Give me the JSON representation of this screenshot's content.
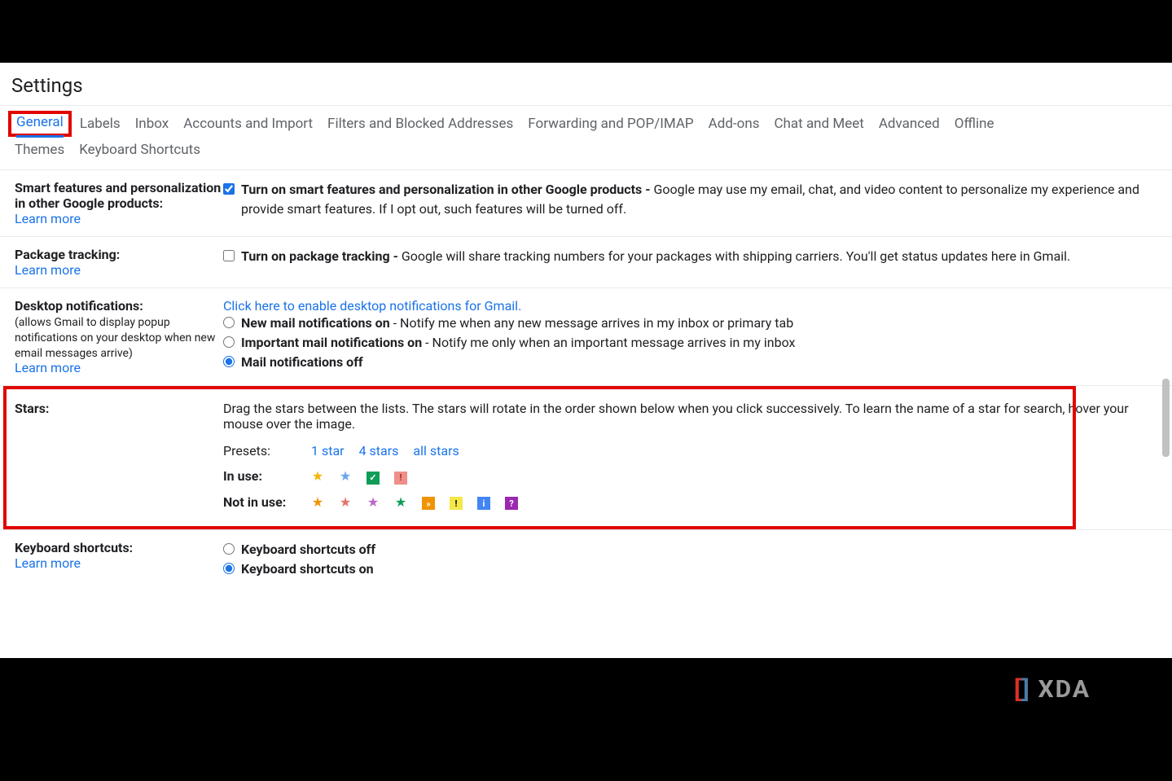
{
  "page_title": "Settings",
  "tabs": {
    "row1": [
      "General",
      "Labels",
      "Inbox",
      "Accounts and Import",
      "Filters and Blocked Addresses",
      "Forwarding and POP/IMAP",
      "Add-ons",
      "Chat and Meet",
      "Advanced",
      "Offline"
    ],
    "row2": [
      "Themes",
      "Keyboard Shortcuts"
    ],
    "active": "General"
  },
  "learn_more": "Learn more",
  "sections": {
    "smart_features": {
      "label": "Smart features and personalization in other Google products:",
      "checkbox_label": "Turn on smart features and personalization in other Google products - ",
      "description": "Google may use my email, chat, and video content to personalize my experience and provide smart features. If I opt out, such features will be turned off.",
      "checked": true
    },
    "package_tracking": {
      "label": "Package tracking:",
      "checkbox_label": "Turn on package tracking - ",
      "description": "Google will share tracking numbers for your packages with shipping carriers. You'll get status updates here in Gmail.",
      "checked": false
    },
    "desktop_notifications": {
      "label": "Desktop notifications:",
      "sublabel": "(allows Gmail to display popup notifications on your desktop when new email messages arrive)",
      "enable_link": "Click here to enable desktop notifications for Gmail.",
      "options": [
        {
          "label": "New mail notifications on",
          "desc": " - Notify me when any new message arrives in my inbox or primary tab",
          "checked": false
        },
        {
          "label": "Important mail notifications on",
          "desc": " - Notify me only when an important message arrives in my inbox",
          "checked": false
        },
        {
          "label": "Mail notifications off",
          "desc": "",
          "checked": true
        }
      ]
    },
    "stars": {
      "label": "Stars:",
      "instruction_bold": "Drag the stars between the lists.",
      "instruction_rest": "  The stars will rotate in the order shown below when you click successively. To learn the name of a star for search, hover your mouse over the image.",
      "presets_label": "Presets:",
      "presets": [
        "1 star",
        "4 stars",
        "all stars"
      ],
      "in_use_label": "In use:",
      "in_use": [
        {
          "type": "star",
          "color": "#f4b400",
          "name": "yellow-star"
        },
        {
          "type": "star",
          "color": "#6ba4ef",
          "name": "blue-star"
        },
        {
          "type": "square",
          "bg": "#0f9d58",
          "char": "✓",
          "name": "green-check"
        },
        {
          "type": "square",
          "bg": "#ef8f8a",
          "char": "!",
          "txt": "#a52714",
          "name": "red-bang"
        }
      ],
      "not_in_use_label": "Not in use:",
      "not_in_use": [
        {
          "type": "star",
          "color": "#f09300",
          "name": "orange-star"
        },
        {
          "type": "star",
          "color": "#e57368",
          "name": "red-star"
        },
        {
          "type": "star",
          "color": "#ba68c8",
          "name": "purple-star"
        },
        {
          "type": "star",
          "color": "#0f9d58",
          "name": "green-star"
        },
        {
          "type": "square",
          "bg": "#f09300",
          "char": "»",
          "name": "orange-guillemet"
        },
        {
          "type": "square",
          "bg": "#f4e74a",
          "char": "!",
          "txt": "#000",
          "name": "yellow-bang"
        },
        {
          "type": "square",
          "bg": "#4285f4",
          "char": "i",
          "name": "blue-info"
        },
        {
          "type": "square",
          "bg": "#9c27b0",
          "char": "?",
          "name": "purple-question"
        }
      ]
    },
    "keyboard_shortcuts": {
      "label": "Keyboard shortcuts:",
      "options": [
        {
          "label": "Keyboard shortcuts off",
          "checked": false
        },
        {
          "label": "Keyboard shortcuts on",
          "checked": true
        }
      ]
    }
  },
  "watermark": "XDA"
}
